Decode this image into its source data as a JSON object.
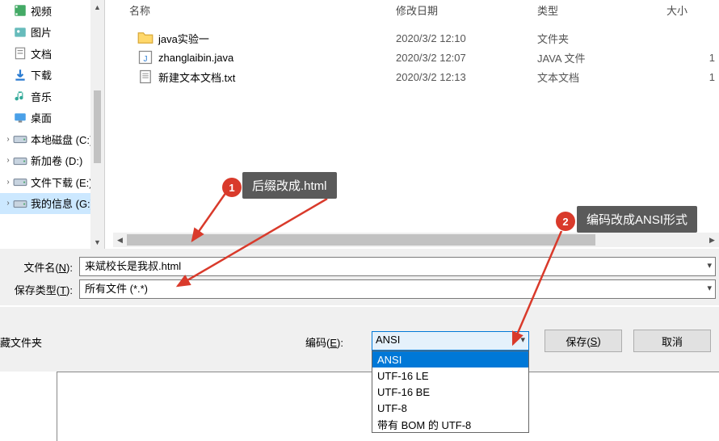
{
  "sidebar": {
    "items": [
      {
        "label": "视频",
        "icon": "film"
      },
      {
        "label": "图片",
        "icon": "image"
      },
      {
        "label": "文档",
        "icon": "doc"
      },
      {
        "label": "下载",
        "icon": "down"
      },
      {
        "label": "音乐",
        "icon": "music"
      },
      {
        "label": "桌面",
        "icon": "desk"
      },
      {
        "label": "本地磁盘 (C:)",
        "icon": "drive"
      },
      {
        "label": "新加卷 (D:)",
        "icon": "drive"
      },
      {
        "label": "文件下载 (E:)",
        "icon": "drive"
      },
      {
        "label": "我的信息 (G:)",
        "icon": "drive"
      }
    ],
    "selected_index": 9
  },
  "columns": {
    "name": "名称",
    "date": "修改日期",
    "type": "类型",
    "size": "大小"
  },
  "files": [
    {
      "icon": "folder",
      "name": "java实验一",
      "date": "2020/3/2 12:10",
      "type": "文件夹",
      "size": ""
    },
    {
      "icon": "java",
      "name": "zhanglaibin.java",
      "date": "2020/3/2 12:07",
      "type": "JAVA 文件",
      "size": "1"
    },
    {
      "icon": "text",
      "name": "新建文本文档.txt",
      "date": "2020/3/2 12:13",
      "type": "文本文档",
      "size": "1"
    }
  ],
  "form": {
    "filename_label_pre": "文件名(",
    "filename_label_u": "N",
    "filename_label_post": "):",
    "filename_value": "来斌校长是我叔.html",
    "filetype_label_pre": "保存类型(",
    "filetype_label_u": "T",
    "filetype_label_post": "):",
    "filetype_value": "所有文件  (*.*)"
  },
  "encoding": {
    "hide_folders": "藏文件夹",
    "label_pre": "编码(",
    "label_u": "E",
    "label_post": "):",
    "selected": "ANSI",
    "options": [
      "ANSI",
      "UTF-16 LE",
      "UTF-16 BE",
      "UTF-8",
      "带有 BOM 的 UTF-8"
    ],
    "highlight_index": 0
  },
  "buttons": {
    "save_pre": "保存(",
    "save_u": "S",
    "save_post": ")",
    "cancel": "取消"
  },
  "annotations": {
    "n1": "1",
    "n2": "2",
    "text1": "后缀改成.html",
    "text2": "编码改成ANSI形式"
  }
}
